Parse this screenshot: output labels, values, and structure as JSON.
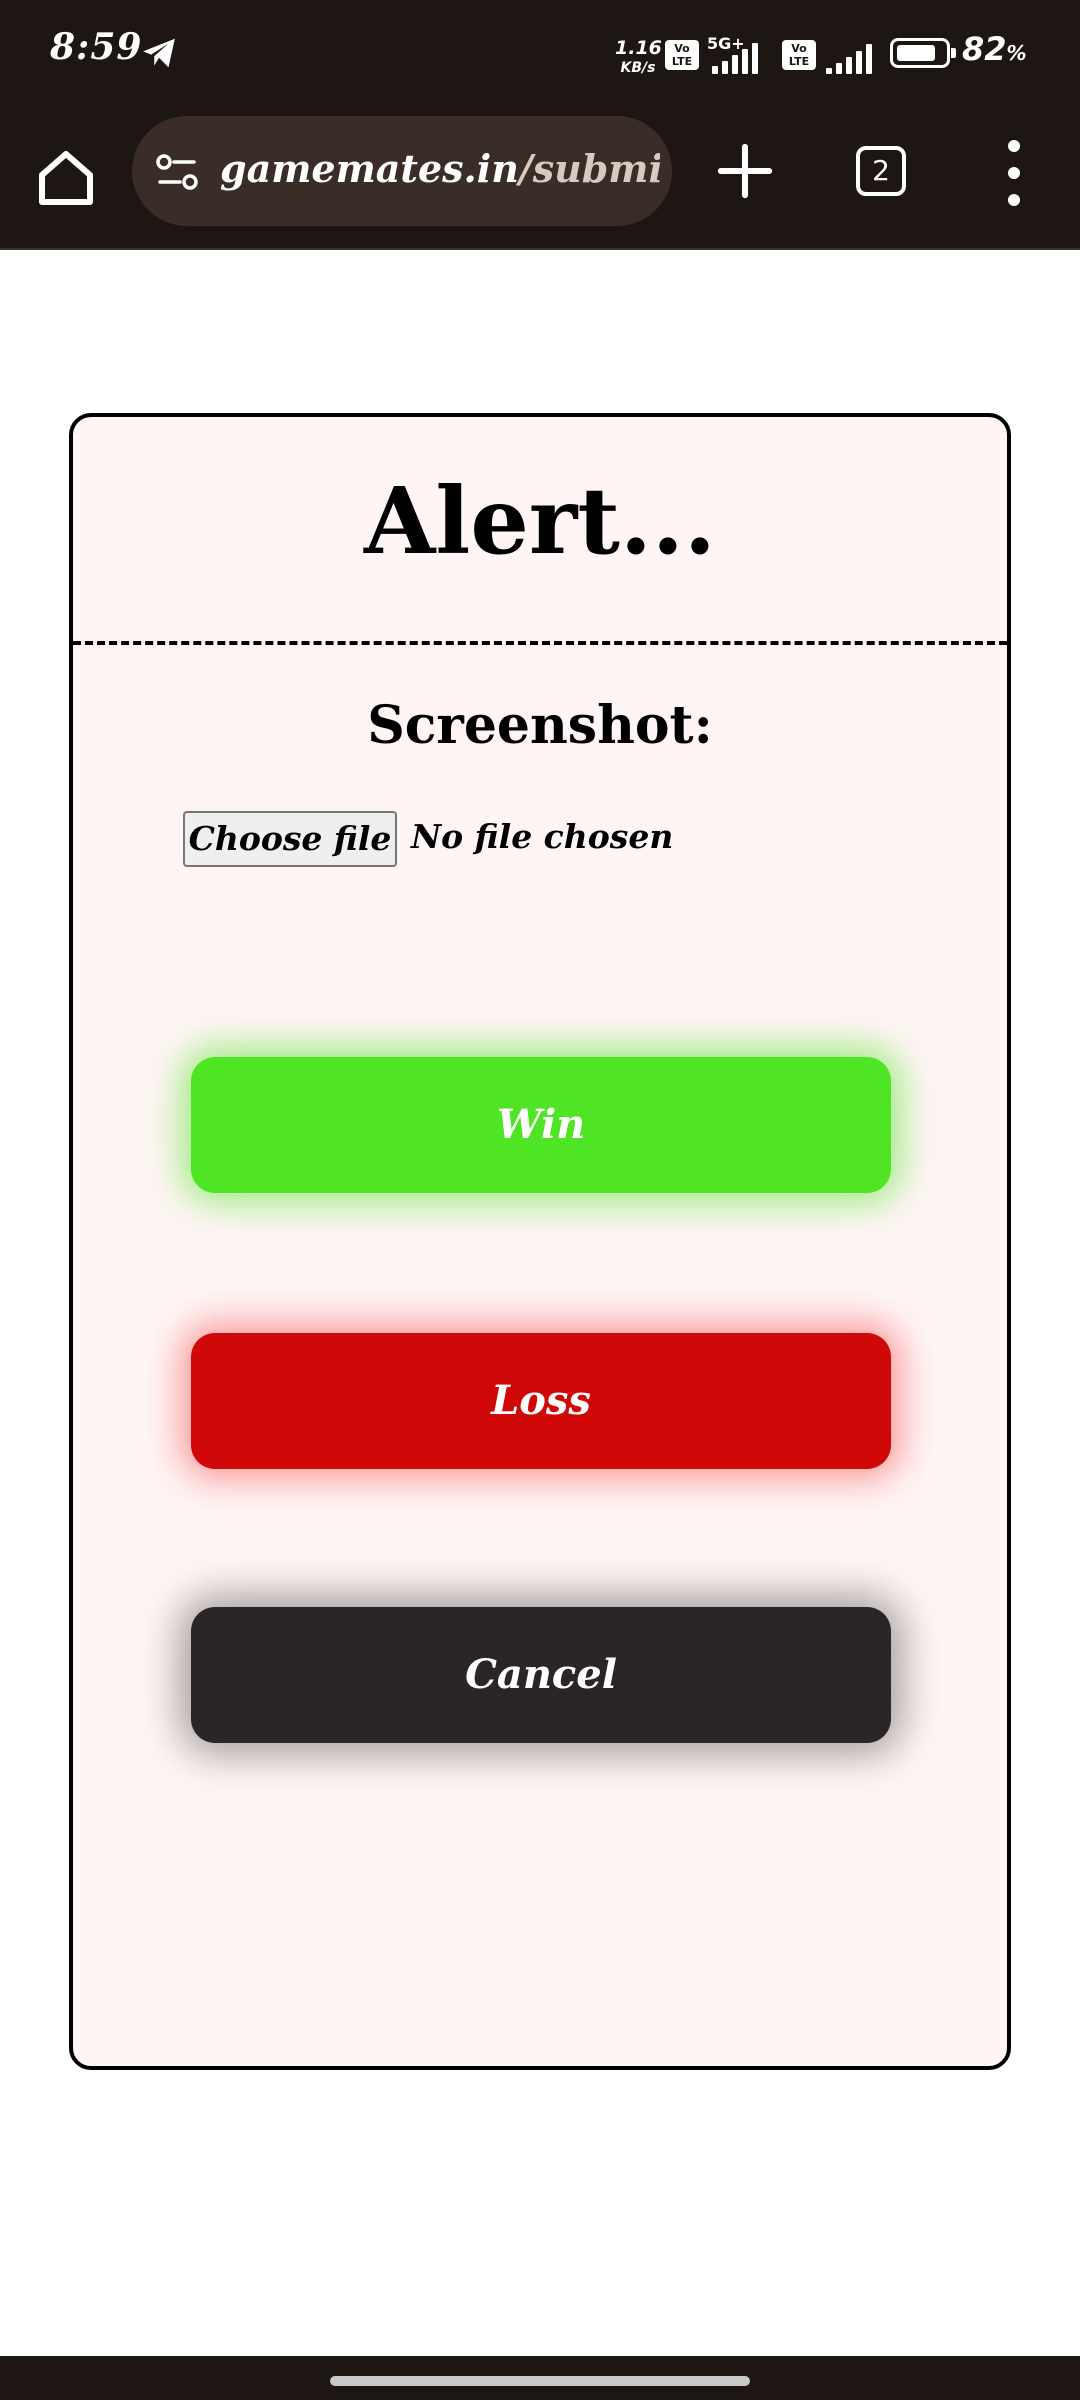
{
  "status_bar": {
    "time": "8:59",
    "net_speed_value": "1.16",
    "net_speed_unit": "KB/s",
    "sim1_badge": "Vo LTE",
    "network_type": "5G+",
    "sim2_badge": "Vo LTE",
    "battery_level": 82,
    "battery_value": "82",
    "battery_unit": "%",
    "icons": [
      "telegram-icon",
      "signal-icon",
      "signal-icon",
      "battery-icon"
    ]
  },
  "browser": {
    "url_domain": "gamemates.in",
    "url_path": "/submit_",
    "tab_count": "2",
    "icons": [
      "home-icon",
      "site-settings-icon",
      "plus-icon",
      "tabs-icon",
      "menu-icon"
    ]
  },
  "modal": {
    "title": "Alert...",
    "section_label": "Screenshot:",
    "file_input": {
      "button_label": "Choose file",
      "status": "No file chosen"
    },
    "buttons": {
      "win": "Win",
      "loss": "Loss",
      "cancel": "Cancel"
    }
  },
  "colors": {
    "win": "#4fe424",
    "loss": "#d00808",
    "cancel": "#2b2625",
    "modal_bg": "#fff5f5",
    "chrome_bg": "#1e1613"
  }
}
